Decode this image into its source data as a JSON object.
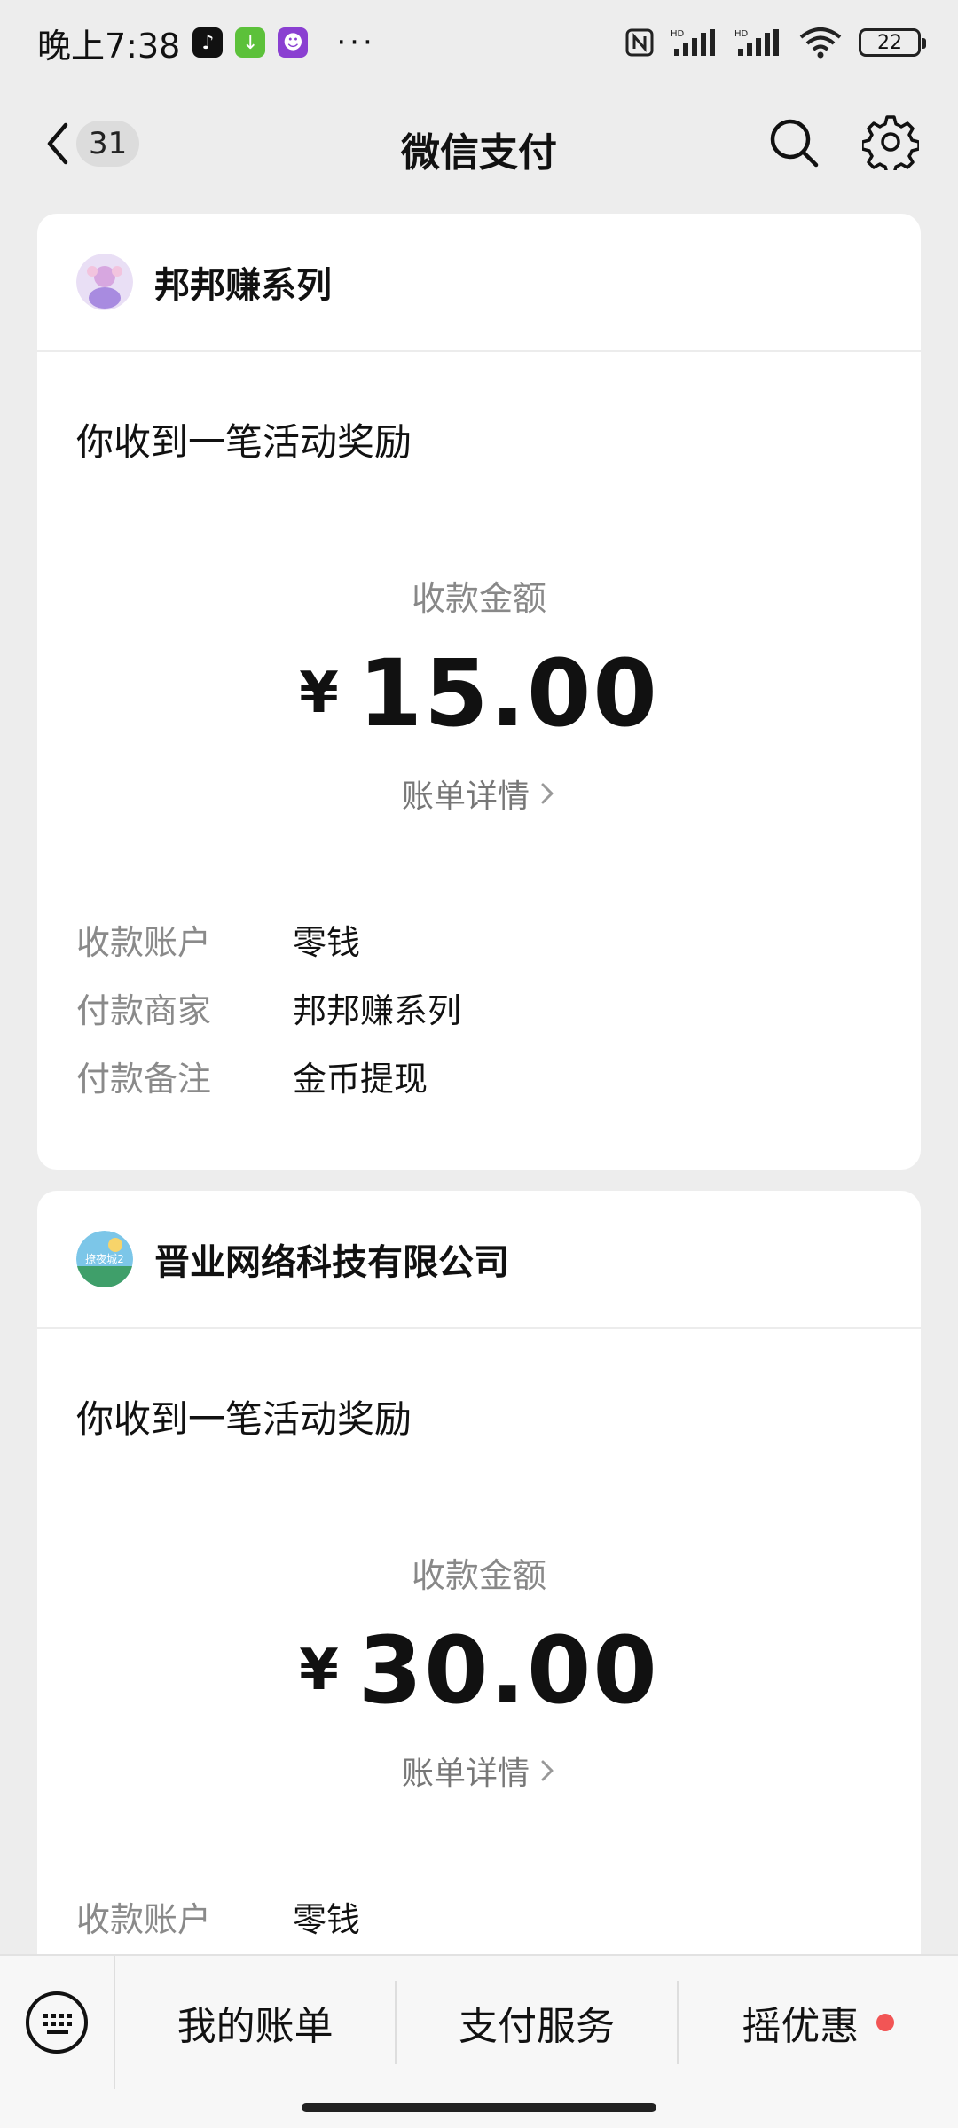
{
  "status_bar": {
    "time": "晚上7:38",
    "dots": "···",
    "battery": "22",
    "network_labels": [
      "HD",
      "HD"
    ]
  },
  "nav": {
    "unread_count": "31",
    "title": "微信支付"
  },
  "cards": [
    {
      "merchant": "邦邦赚系列",
      "message": "你收到一笔活动奖励",
      "amount_label": "收款金额",
      "currency": "¥",
      "amount": "15.00",
      "detail_link": "账单详情",
      "rows": [
        {
          "key": "收款账户",
          "value": "零钱"
        },
        {
          "key": "付款商家",
          "value": "邦邦赚系列"
        },
        {
          "key": "付款备注",
          "value": "金币提现"
        }
      ]
    },
    {
      "merchant": "晋业网络科技有限公司",
      "message": "你收到一笔活动奖励",
      "amount_label": "收款金额",
      "currency": "¥",
      "amount": "30.00",
      "detail_link": "账单详情",
      "avatar_caption": "撩夜城2",
      "rows": [
        {
          "key": "收款账户",
          "value": "零钱"
        }
      ]
    }
  ],
  "bottom_bar": {
    "items": [
      "我的账单",
      "支付服务",
      "摇优惠"
    ],
    "badge_color": "#f25555"
  },
  "colors": {
    "background": "#ededed",
    "card": "#ffffff",
    "muted_text": "#888888"
  }
}
